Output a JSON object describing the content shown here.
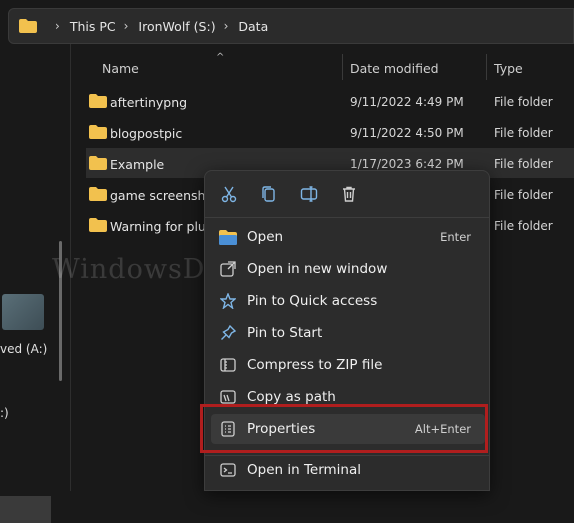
{
  "address_bar": {
    "icon": "folder-icon",
    "crumbs": [
      "This PC",
      "IronWolf (S:)",
      "Data"
    ]
  },
  "left_pane": {
    "drive_label": "ved (A:)",
    "other_label": ":)"
  },
  "columns": {
    "name": "Name",
    "date": "Date modified",
    "type": "Type"
  },
  "files": [
    {
      "name": "aftertinypng",
      "date": "9/11/2022 4:49 PM",
      "type": "File folder"
    },
    {
      "name": "blogpostpic",
      "date": "9/11/2022 4:50 PM",
      "type": "File folder"
    },
    {
      "name": "Example",
      "date": "1/17/2023 6:42 PM",
      "type": "File folder"
    },
    {
      "name": "game screenshot",
      "date": "",
      "type": "File folder"
    },
    {
      "name": "Warning for plugi",
      "date": "",
      "type": "File folder"
    }
  ],
  "context_menu": {
    "quick_actions": [
      "cut-icon",
      "copy-icon",
      "rename-icon",
      "delete-icon"
    ],
    "items": [
      {
        "label": "Open",
        "shortcut": "Enter",
        "icon": "open-folder-icon"
      },
      {
        "label": "Open in new window",
        "shortcut": "",
        "icon": "new-window-icon"
      },
      {
        "label": "Pin to Quick access",
        "shortcut": "",
        "icon": "pin-icon"
      },
      {
        "label": "Pin to Start",
        "shortcut": "",
        "icon": "pin-start-icon"
      },
      {
        "label": "Compress to ZIP file",
        "shortcut": "",
        "icon": "zip-icon"
      },
      {
        "label": "Copy as path",
        "shortcut": "",
        "icon": "copy-path-icon"
      },
      {
        "label": "Properties",
        "shortcut": "Alt+Enter",
        "icon": "properties-icon"
      },
      {
        "label": "Open in Terminal",
        "shortcut": "",
        "icon": "terminal-icon"
      }
    ]
  },
  "watermark": "WindowsDigitals.com",
  "colors": {
    "folder": "#f2c14e",
    "highlight_box": "#b01e1e",
    "accent": "#7fb6e6"
  }
}
